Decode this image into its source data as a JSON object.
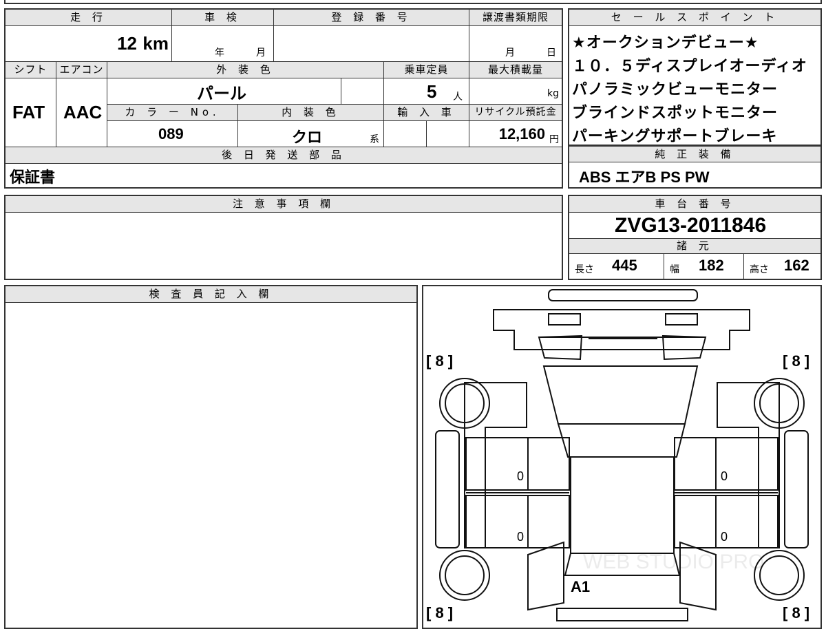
{
  "headers": {
    "mileage": "走 行",
    "inspection": "車 検",
    "registration": "登 録 番 号",
    "transfer_deadline": "譲渡書類期限",
    "shift": "シフト",
    "aircon": "エアコン",
    "exterior_color": "外 装 色",
    "capacity": "乗車定員",
    "max_load": "最大積載量",
    "color_no": "カ ラ ー No.",
    "interior_color": "内 装 色",
    "import_car": "輸 入 車",
    "recycle_fee": "リサイクル預託金",
    "later_parts": "後 日 発 送 部 品",
    "sale_points": "セ ー ル ス ポ イ ン ト",
    "genuine_equipment": "純 正 装 備",
    "notes": "注 意 事 項 欄",
    "chassis_number": "車 台 番 号",
    "specs": "諸 元",
    "inspector": "検 査 員 記 入 欄"
  },
  "values": {
    "mileage": "12",
    "mileage_unit": "km",
    "inspection_year_unit": "年",
    "inspection_month_unit": "月",
    "transfer_month_unit": "月",
    "transfer_day_unit": "日",
    "shift": "FAT",
    "aircon": "AAC",
    "exterior_color": "パール",
    "capacity": "5",
    "capacity_unit": "人",
    "max_load_unit": "kg",
    "color_no": "089",
    "interior_color": "クロ",
    "interior_suffix": "系",
    "recycle_fee": "12,160",
    "recycle_unit": "円",
    "later_parts": "保証書",
    "genuine_equipment": "ABS エアB PS PW",
    "chassis_number": "ZVG13-2011846",
    "length_label": "長さ",
    "length": "445",
    "width_label": "幅",
    "width": "182",
    "height_label": "高さ",
    "height": "162"
  },
  "sale_points": [
    "★オークションデビュー★",
    "１０．５ディスプレイオーディオ",
    "パノラミックビューモニター",
    "ブラインドスポットモニター",
    "パーキングサポートブレーキ"
  ],
  "diagram": {
    "tire_fl": "[ 8 ]",
    "tire_fr": "[ 8 ]",
    "tire_rl": "[ 8 ]",
    "tire_rr": "[ 8 ]",
    "door_fl": "0",
    "door_fr": "0",
    "door_rl": "0",
    "door_rr": "0",
    "damage_mark": "A1",
    "watermark": "WEB STUDIO PRO"
  },
  "colors": {
    "border": "#333333",
    "header_bg": "#e6e6e6"
  }
}
